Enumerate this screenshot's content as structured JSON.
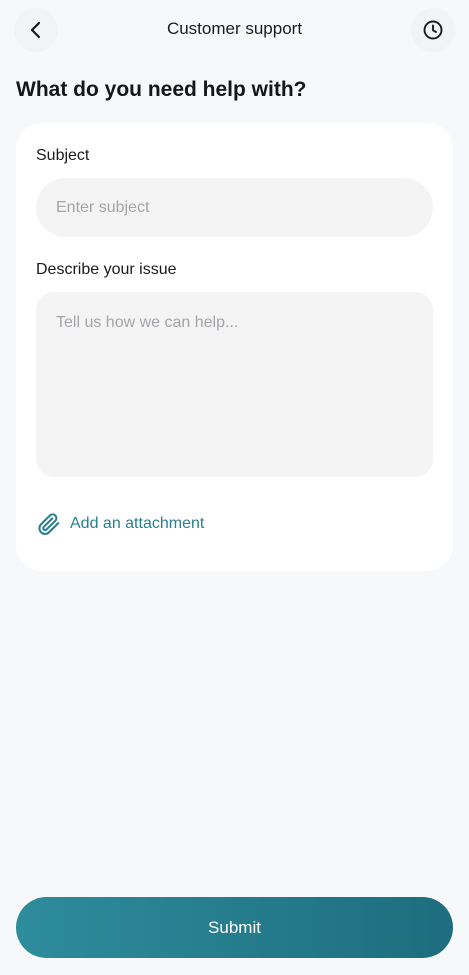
{
  "header": {
    "title": "Customer support",
    "back_icon": "chevron-left-icon",
    "history_icon": "clock-icon"
  },
  "page": {
    "title": "What do you need help with?"
  },
  "form": {
    "subject_label": "Subject",
    "subject_placeholder": "Enter subject",
    "subject_value": "",
    "issue_label": "Describe your issue",
    "issue_placeholder": "Tell us how we can help...",
    "issue_value": "",
    "attachment_label": "Add an attachment",
    "attachment_icon": "paperclip-icon"
  },
  "submit": {
    "label": "Submit"
  },
  "colors": {
    "accent": "#2a7f8e",
    "button_gradient_start": "#2e8c9c",
    "button_gradient_end": "#1d6d7e",
    "background": "#f6f8f9",
    "field_background": "#f4f4f5"
  }
}
